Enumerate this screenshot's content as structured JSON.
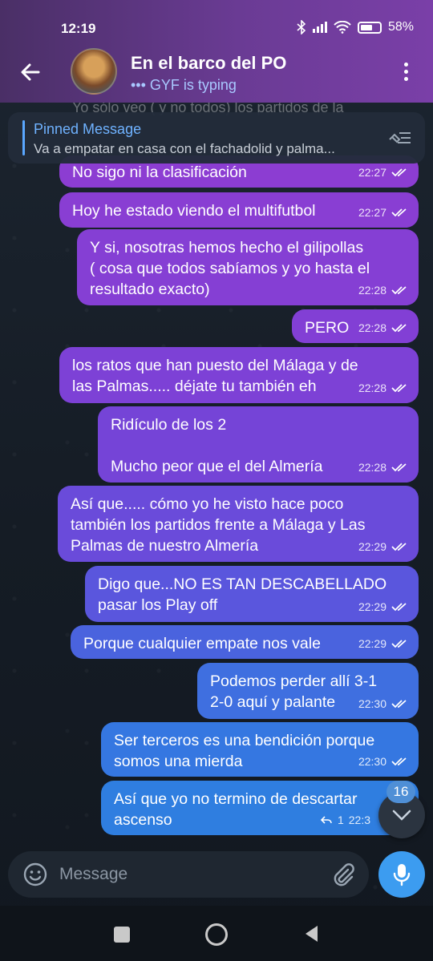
{
  "status_bar": {
    "time": "12:19",
    "battery": "58%"
  },
  "header": {
    "title": "En el barco del PO",
    "subtitle": "GYF is typing"
  },
  "faded_message": "Yo sólo veo ( y no todos) los partidos de la",
  "pinned": {
    "label": "Pinned Message",
    "text": "Va a empatar en casa con el fachadolid y palma..."
  },
  "messages": [
    {
      "text": "No sigo ni la clasificación",
      "time": "22:27"
    },
    {
      "text": "Hoy he estado viendo el multifutbol",
      "time": "22:27"
    },
    {
      "text": "Y si, nosotras hemos hecho el gilipollas\n( cosa que todos sabíamos y yo hasta el\nresultado exacto)",
      "time": "22:28"
    },
    {
      "text": "PERO",
      "time": "22:28"
    },
    {
      "text": "los ratos que han puesto del Málaga y de\nlas Palmas..... déjate tu también eh",
      "time": "22:28"
    },
    {
      "text": "Ridículo de los 2\n\nMucho peor que el del Almería",
      "time": "22:28"
    },
    {
      "text": "Así que..... cómo yo he visto hace poco\ntambién los partidos frente a Málaga y Las\nPalmas de nuestro Almería",
      "time": "22:29"
    },
    {
      "text": "Digo que...NO ES TAN DESCABELLADO\npasar los Play off",
      "time": "22:29"
    },
    {
      "text": "Porque cualquier empate nos vale",
      "time": "22:29"
    },
    {
      "text": "Podemos perder allí 3-1\n2-0 aquí y palante",
      "time": "22:30"
    },
    {
      "text": "Ser terceros es una bendición porque\nsomos una mierda",
      "time": "22:30"
    },
    {
      "text": "Así que yo no termino de descartar\nascenso",
      "time": "22:3",
      "replies": "1"
    }
  ],
  "scroll_badge": "16",
  "composer": {
    "placeholder": "Message"
  },
  "colors": {
    "header_start": "#4a2f66",
    "header_end": "#7a3fa8",
    "bubble_purple": "#8a3fd0",
    "bubble_blue": "#2f7ee0",
    "accent": "#3c9cf0"
  }
}
